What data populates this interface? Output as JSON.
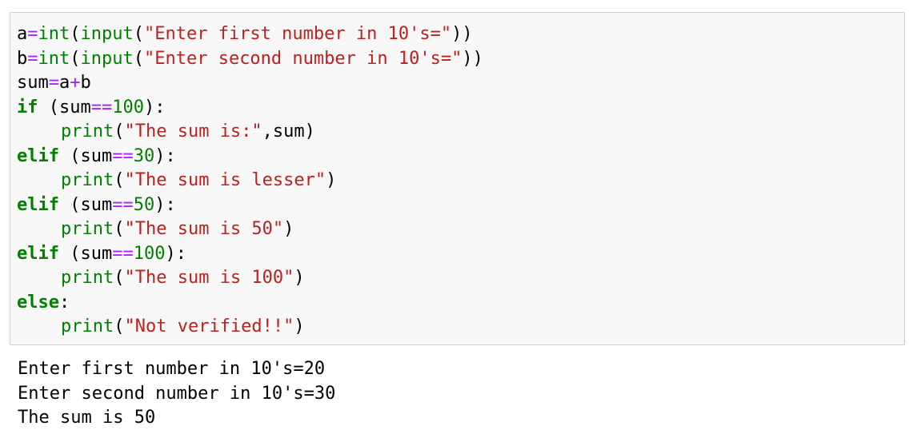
{
  "code": {
    "lines": [
      {
        "tokens": [
          {
            "t": "a",
            "c": "var"
          },
          {
            "t": "=",
            "c": "op"
          },
          {
            "t": "int",
            "c": "bi"
          },
          {
            "t": "(",
            "c": "var"
          },
          {
            "t": "input",
            "c": "bi"
          },
          {
            "t": "(",
            "c": "var"
          },
          {
            "t": "\"Enter first number in 10's=\"",
            "c": "str"
          },
          {
            "t": "))",
            "c": "var"
          }
        ]
      },
      {
        "tokens": [
          {
            "t": "b",
            "c": "var"
          },
          {
            "t": "=",
            "c": "op"
          },
          {
            "t": "int",
            "c": "bi"
          },
          {
            "t": "(",
            "c": "var"
          },
          {
            "t": "input",
            "c": "bi"
          },
          {
            "t": "(",
            "c": "var"
          },
          {
            "t": "\"Enter second number in 10's=\"",
            "c": "str"
          },
          {
            "t": "))",
            "c": "var"
          }
        ]
      },
      {
        "tokens": [
          {
            "t": "sum",
            "c": "var"
          },
          {
            "t": "=",
            "c": "op"
          },
          {
            "t": "a",
            "c": "var"
          },
          {
            "t": "+",
            "c": "op"
          },
          {
            "t": "b",
            "c": "var"
          }
        ]
      },
      {
        "tokens": [
          {
            "t": "if",
            "c": "kw"
          },
          {
            "t": " (sum",
            "c": "var"
          },
          {
            "t": "==",
            "c": "op"
          },
          {
            "t": "100",
            "c": "num"
          },
          {
            "t": "):",
            "c": "var"
          }
        ]
      },
      {
        "indent": true,
        "tokens": [
          {
            "t": "print",
            "c": "bi"
          },
          {
            "t": "(",
            "c": "var"
          },
          {
            "t": "\"The sum is:\"",
            "c": "str"
          },
          {
            "t": ",sum)",
            "c": "var"
          }
        ]
      },
      {
        "tokens": [
          {
            "t": "elif",
            "c": "kw"
          },
          {
            "t": " (sum",
            "c": "var"
          },
          {
            "t": "==",
            "c": "op"
          },
          {
            "t": "30",
            "c": "num"
          },
          {
            "t": "):",
            "c": "var"
          }
        ]
      },
      {
        "indent": true,
        "tokens": [
          {
            "t": "print",
            "c": "bi"
          },
          {
            "t": "(",
            "c": "var"
          },
          {
            "t": "\"The sum is lesser\"",
            "c": "str"
          },
          {
            "t": ")",
            "c": "var"
          }
        ]
      },
      {
        "tokens": [
          {
            "t": "elif",
            "c": "kw"
          },
          {
            "t": " (sum",
            "c": "var"
          },
          {
            "t": "==",
            "c": "op"
          },
          {
            "t": "50",
            "c": "num"
          },
          {
            "t": "):",
            "c": "var"
          }
        ]
      },
      {
        "indent": true,
        "tokens": [
          {
            "t": "print",
            "c": "bi"
          },
          {
            "t": "(",
            "c": "var"
          },
          {
            "t": "\"The sum is 50\"",
            "c": "str"
          },
          {
            "t": ")",
            "c": "var"
          }
        ]
      },
      {
        "tokens": [
          {
            "t": "elif",
            "c": "kw"
          },
          {
            "t": " (sum",
            "c": "var"
          },
          {
            "t": "==",
            "c": "op"
          },
          {
            "t": "100",
            "c": "num"
          },
          {
            "t": "):",
            "c": "var"
          }
        ]
      },
      {
        "indent": true,
        "tokens": [
          {
            "t": "print",
            "c": "bi"
          },
          {
            "t": "(",
            "c": "var"
          },
          {
            "t": "\"The sum is 100\"",
            "c": "str"
          },
          {
            "t": ")",
            "c": "var"
          }
        ]
      },
      {
        "tokens": [
          {
            "t": "else",
            "c": "kw"
          },
          {
            "t": ":",
            "c": "var"
          }
        ]
      },
      {
        "indent": true,
        "tokens": [
          {
            "t": "print",
            "c": "bi"
          },
          {
            "t": "(",
            "c": "var"
          },
          {
            "t": "\"Not verified!!\"",
            "c": "str"
          },
          {
            "t": ")",
            "c": "var"
          }
        ]
      }
    ]
  },
  "output": {
    "lines": [
      "Enter first number in 10's=20",
      "Enter second number in 10's=30",
      "The sum is 50"
    ]
  },
  "colors": {
    "cell_background": "#f7f7f7",
    "cell_border": "#cfcfcf",
    "keyword": "#008000",
    "builtin": "#008000",
    "string": "#ba2121",
    "number": "#008000",
    "operator": "#aa22ff"
  }
}
